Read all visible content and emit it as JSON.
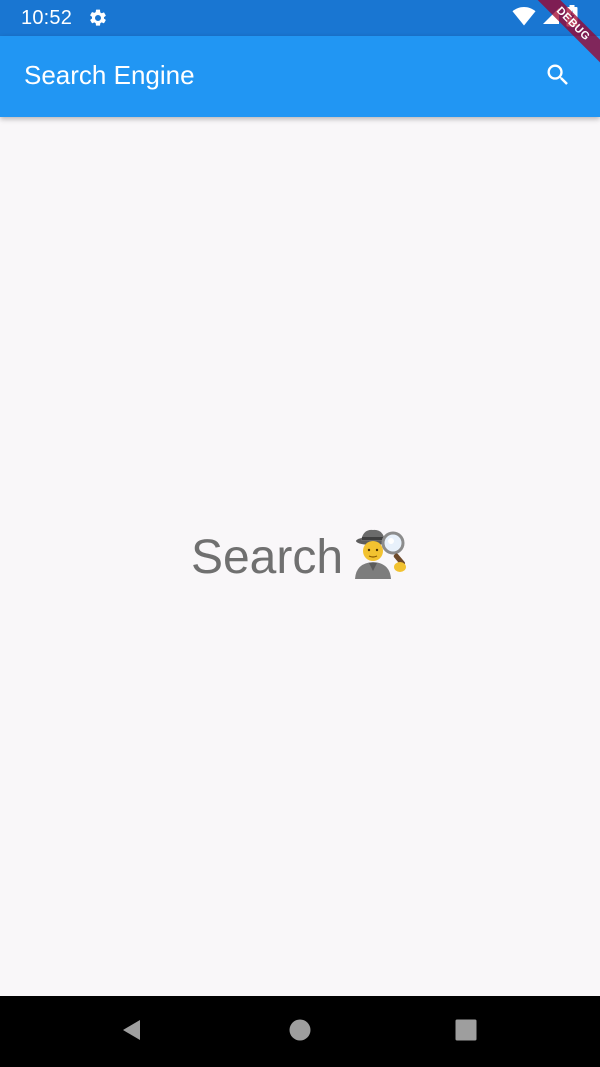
{
  "status_bar": {
    "time": "10:52",
    "color": "#1976d2"
  },
  "app_bar": {
    "title": "Search Engine",
    "color": "#2196f3",
    "action_icon": "search-icon"
  },
  "debug_banner": {
    "label": "DEBUG"
  },
  "body": {
    "message": "Search",
    "emoji_icon": "detective-emoji-icon"
  },
  "nav_bar": {
    "buttons": [
      "back-icon",
      "home-icon",
      "recents-icon"
    ]
  }
}
